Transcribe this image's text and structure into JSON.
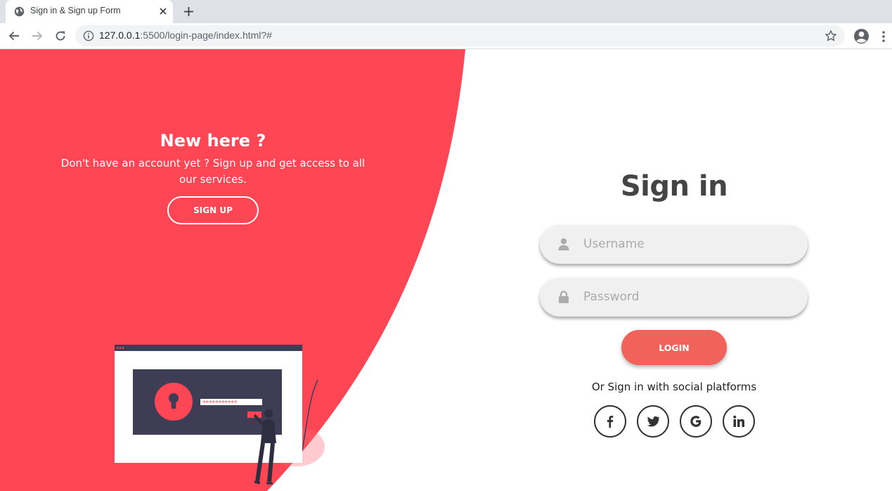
{
  "browser": {
    "tab_title": "Sign in & Sign up Form",
    "url_host": "127.0.0.1",
    "url_rest": ":5500/login-page/index.html?#"
  },
  "left_panel": {
    "title": "New here ?",
    "text": "Don't have an account yet ? Sign up and get access to all our services.",
    "button_label": "SIGN UP"
  },
  "form": {
    "title": "Sign in",
    "username_placeholder": "Username",
    "password_placeholder": "Password",
    "login_label": "LOGIN",
    "social_text": "Or Sign in with social platforms",
    "social_icons": [
      "facebook-icon",
      "twitter-icon",
      "google-icon",
      "linkedin-icon"
    ]
  },
  "colors": {
    "accent_red": "#ff4655",
    "button_coral": "#f0625a",
    "title_gray": "#444444",
    "illustration_dark": "#3f3d56"
  }
}
